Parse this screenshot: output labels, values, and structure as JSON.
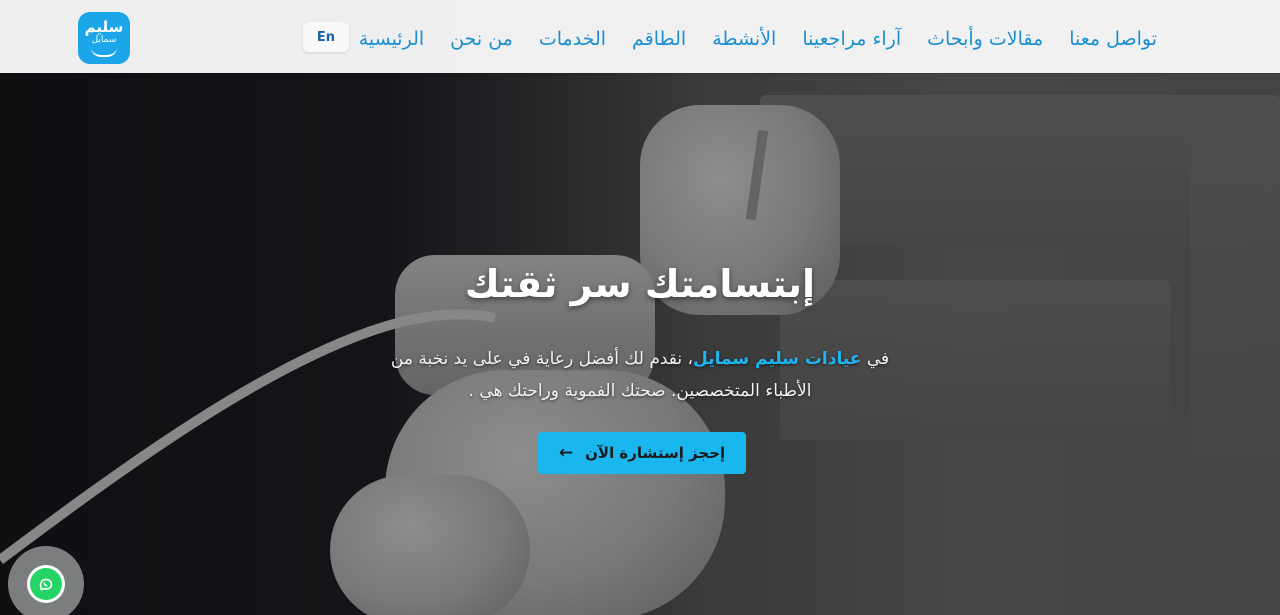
{
  "colors": {
    "accent": "#1ab6ee",
    "nav_text": "#1d8fd1",
    "brand_highlight": "#1fb5f0",
    "whatsapp": "#25d366"
  },
  "logo": {
    "line1": "سليم",
    "line2": "سمايل"
  },
  "language_switch": "En",
  "nav": {
    "items": [
      {
        "label": "الرئيسية"
      },
      {
        "label": "من نحن"
      },
      {
        "label": "الخدمات"
      },
      {
        "label": "الطاقم"
      },
      {
        "label": "الأنشطة"
      },
      {
        "label": "آراء مراجعينا"
      },
      {
        "label": "مقالات وأبحاث"
      },
      {
        "label": "تواصل معنا"
      }
    ]
  },
  "hero": {
    "title": "إبتسامتك سر ثقتك",
    "subtitle_prefix": "في",
    "subtitle_brand": "عيادات سليم سمايل",
    "subtitle_rest": "، نقدم لك أفضل رعاية في على يد نخبة من الأطباء المتخصصين. صحتك الفموية وراحتك هي .",
    "cta_label": "إحجز إستشارة الآن",
    "cta_icon": "arrow-left-icon"
  },
  "floating": {
    "whatsapp_icon": "whatsapp-icon"
  }
}
